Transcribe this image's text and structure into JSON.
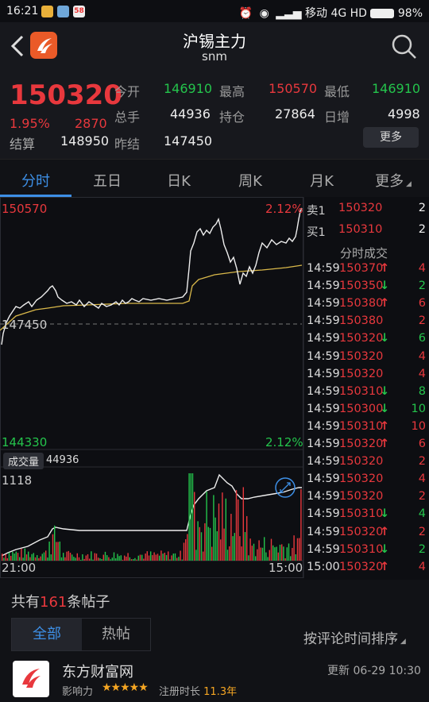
{
  "status_bar": {
    "time": "16:21",
    "carrier": "移动",
    "network": "4G HD",
    "battery": "98%",
    "app_badge": "58"
  },
  "header": {
    "title": "沪锡主力",
    "subtitle": "snm"
  },
  "quote": {
    "last_price": "150320",
    "change_pct": "1.95%",
    "change_abs": "2870",
    "fields": {
      "open_label": "今开",
      "open_value": "146910",
      "high_label": "最高",
      "high_value": "150570",
      "low_label": "最低",
      "low_value": "146910",
      "volume_label": "总手",
      "volume_value": "44936",
      "oi_label": "持仓",
      "oi_value": "27864",
      "oi_change_label": "日增",
      "oi_change_value": "4998",
      "settle_label": "结算",
      "settle_value": "148950",
      "prev_settle_label": "昨结",
      "prev_settle_value": "147450"
    },
    "more_label": "更多"
  },
  "tabs": [
    "分时",
    "五日",
    "日K",
    "周K",
    "月K",
    "更多"
  ],
  "active_tab": 0,
  "chart": {
    "top_price": "150570",
    "top_pct": "2.12%",
    "bottom_price": "144330",
    "bottom_pct": "2.12%",
    "ref_price": "147450",
    "volume_label": "成交量",
    "volume_total": "44936",
    "volume_max": "1118",
    "time_start": "21:00",
    "time_end": "15:00"
  },
  "order_book": [
    {
      "label": "卖1",
      "price": "150320",
      "qty": "2"
    },
    {
      "label": "买1",
      "price": "150310",
      "qty": "2"
    }
  ],
  "trades_title": "分时成交",
  "trades": [
    {
      "time": "14:59",
      "price": "150370",
      "arrow": "↑",
      "qty": "4",
      "qty_color": "red"
    },
    {
      "time": "14:59",
      "price": "150350",
      "arrow": "↓",
      "qty": "2",
      "qty_color": "green"
    },
    {
      "time": "14:59",
      "price": "150380",
      "arrow": "↑",
      "qty": "6",
      "qty_color": "red"
    },
    {
      "time": "14:59",
      "price": "150380",
      "arrow": "",
      "qty": "2",
      "qty_color": "red"
    },
    {
      "time": "14:59",
      "price": "150320",
      "arrow": "↓",
      "qty": "6",
      "qty_color": "green"
    },
    {
      "time": "14:59",
      "price": "150320",
      "arrow": "",
      "qty": "4",
      "qty_color": "red"
    },
    {
      "time": "14:59",
      "price": "150320",
      "arrow": "",
      "qty": "4",
      "qty_color": "red"
    },
    {
      "time": "14:59",
      "price": "150310",
      "arrow": "↓",
      "qty": "8",
      "qty_color": "green"
    },
    {
      "time": "14:59",
      "price": "150300",
      "arrow": "↓",
      "qty": "10",
      "qty_color": "green"
    },
    {
      "time": "14:59",
      "price": "150310",
      "arrow": "↑",
      "qty": "10",
      "qty_color": "red"
    },
    {
      "time": "14:59",
      "price": "150320",
      "arrow": "↑",
      "qty": "6",
      "qty_color": "red"
    },
    {
      "time": "14:59",
      "price": "150320",
      "arrow": "",
      "qty": "2",
      "qty_color": "red"
    },
    {
      "time": "14:59",
      "price": "150320",
      "arrow": "",
      "qty": "4",
      "qty_color": "red"
    },
    {
      "time": "14:59",
      "price": "150320",
      "arrow": "",
      "qty": "2",
      "qty_color": "red"
    },
    {
      "time": "14:59",
      "price": "150310",
      "arrow": "↓",
      "qty": "4",
      "qty_color": "green"
    },
    {
      "time": "14:59",
      "price": "150320",
      "arrow": "↑",
      "qty": "2",
      "qty_color": "red"
    },
    {
      "time": "14:59",
      "price": "150310",
      "arrow": "↓",
      "qty": "2",
      "qty_color": "green"
    },
    {
      "time": "15:00",
      "price": "150320",
      "arrow": "↑",
      "qty": "4",
      "qty_color": "red"
    }
  ],
  "posts": {
    "count_prefix": "共有",
    "count": "161",
    "count_suffix": "条帖子",
    "tab_all": "全部",
    "tab_hot": "热帖",
    "sort_label": "按评论时间排序",
    "first_post": {
      "author": "东方财富网",
      "influence_label": "影响力",
      "stars": "★★★★★",
      "reg_label": "注册时长",
      "reg_value": "11.3年",
      "updated": "更新 06-29 10:30"
    }
  },
  "colors": {
    "up": "#e8383d",
    "down": "#24c44c",
    "accent": "#3d8fe6",
    "avg_line": "#d9b84a"
  }
}
